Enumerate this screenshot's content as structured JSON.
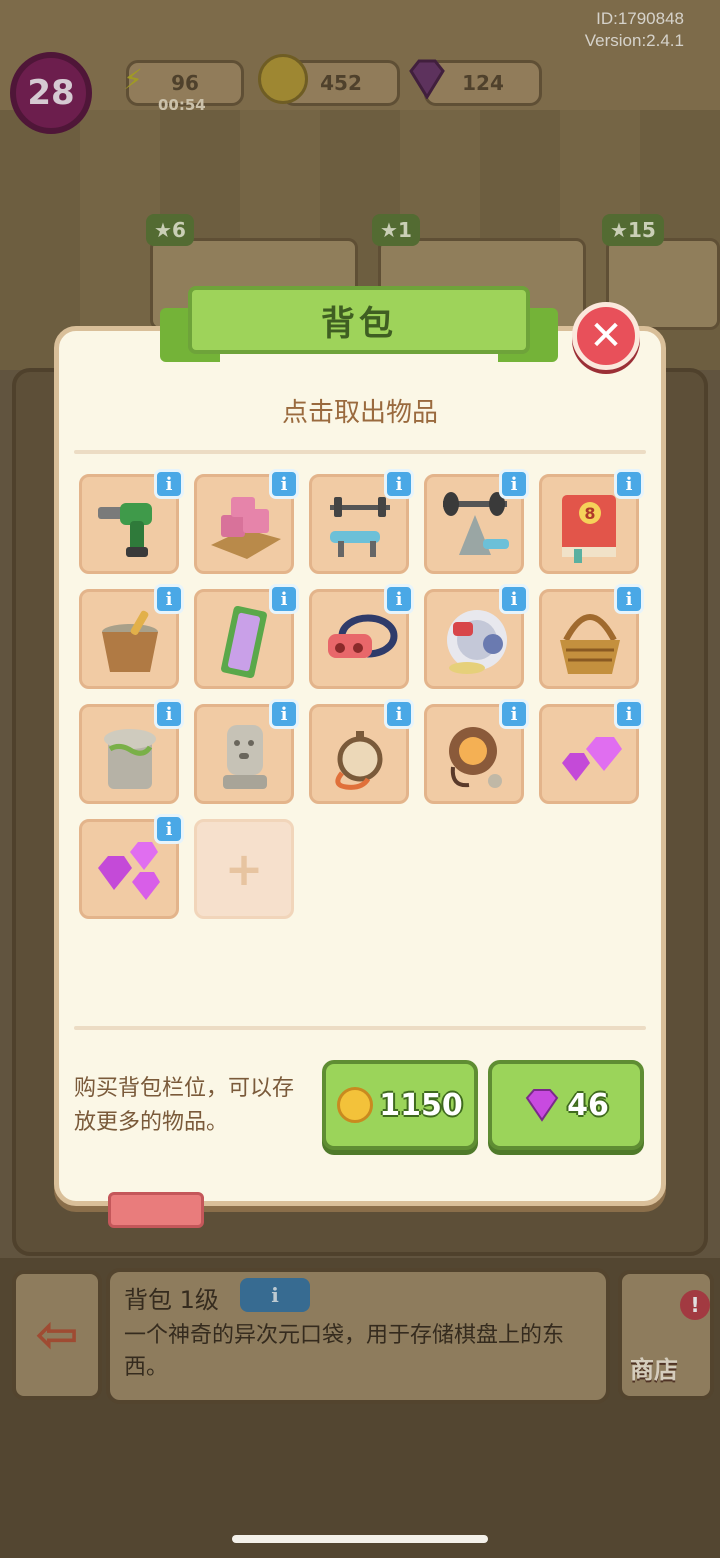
{
  "meta": {
    "id_label": "ID:1790848",
    "version_label": "Version:2.4.1"
  },
  "hud": {
    "level": "28",
    "energy": "96",
    "energy_timer": "00:54",
    "coins": "452",
    "gems": "124"
  },
  "background_cards": [
    {
      "stars": "6"
    },
    {
      "stars": "1"
    },
    {
      "stars": "15"
    }
  ],
  "dialog": {
    "title": "背包",
    "subtitle": "点击取出物品",
    "items": [
      {
        "icon": "drill-icon"
      },
      {
        "icon": "bricks-icon"
      },
      {
        "icon": "bench-press-icon"
      },
      {
        "icon": "weight-machine-icon"
      },
      {
        "icon": "red-book-icon",
        "badge": "8"
      },
      {
        "icon": "mortar-icon"
      },
      {
        "icon": "mirror-icon"
      },
      {
        "icon": "vr-headset-icon"
      },
      {
        "icon": "robot-vacuum-icon"
      },
      {
        "icon": "basket-icon"
      },
      {
        "icon": "stone-pillar-icon"
      },
      {
        "icon": "stone-statue-icon"
      },
      {
        "icon": "stopwatch-icon"
      },
      {
        "icon": "cable-coil-icon"
      },
      {
        "icon": "pink-gems-icon"
      },
      {
        "icon": "pink-gems-icon"
      }
    ],
    "buy_text": "购买背包栏位，可以存放更多的物品。",
    "coin_price": "1150",
    "gem_price": "46"
  },
  "info_panel": {
    "title": "背包 1级",
    "description": "一个神奇的异次元口袋，用于存储棋盘上的东西。",
    "shop_label": "商店",
    "alert": "!"
  },
  "colors": {
    "dialog_bg": "#fbf7e6",
    "ribbon_green": "#9ed35a",
    "button_green": "#9bd45a",
    "close_red": "#e8505a",
    "slot_bg": "#f1cba4",
    "info_blue": "#4aa8e6"
  }
}
